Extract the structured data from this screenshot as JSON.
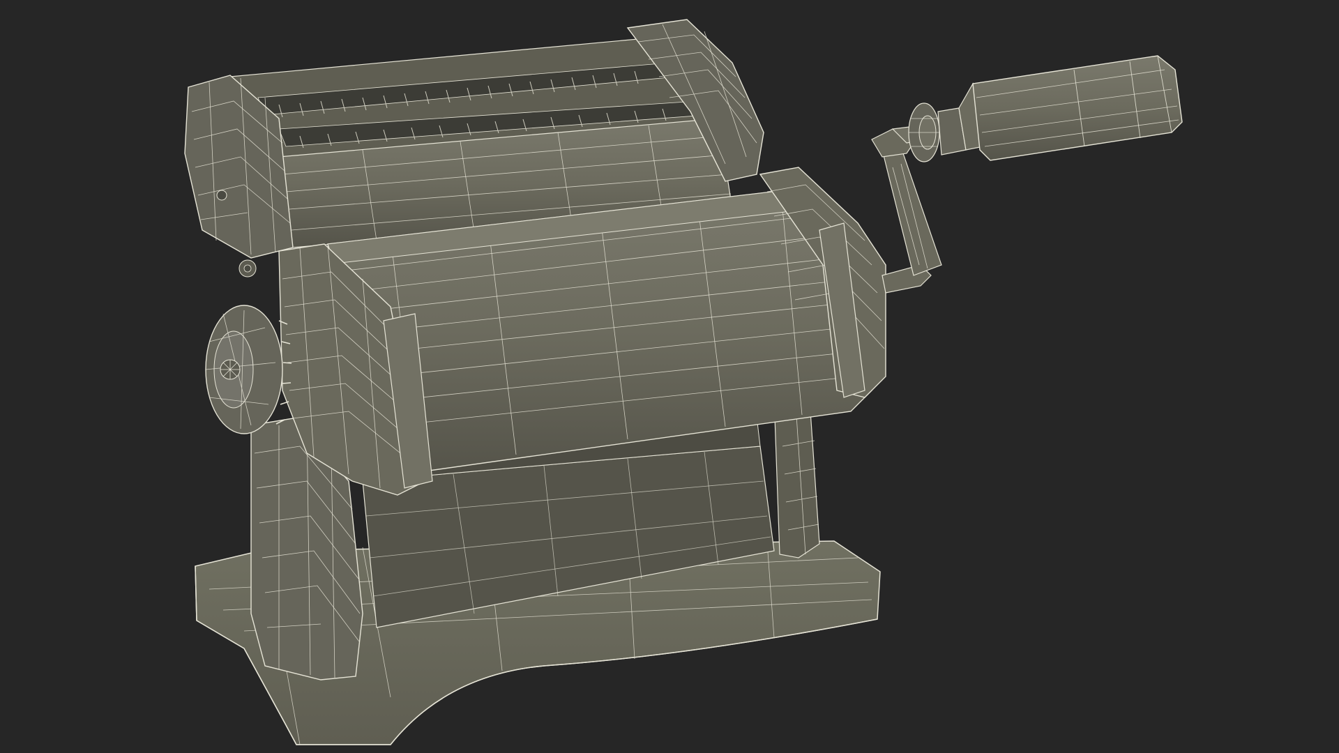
{
  "scene": {
    "subject": "pasta-machine-wireframe",
    "colors": {
      "background": "#262626",
      "surface": "#6c6b5e",
      "surface_dark": "#5a594e",
      "surface_shadow": "#4a4a42",
      "surface_light": "#7a796c",
      "wire": "#e6e4d6"
    }
  }
}
